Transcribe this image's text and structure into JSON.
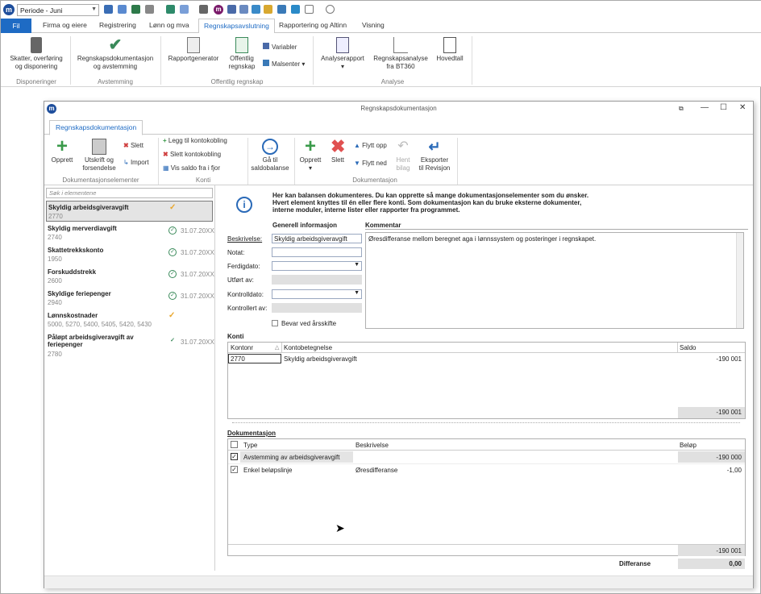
{
  "qat": {
    "period": "Periode - Juni"
  },
  "tabs": {
    "fil": "Fil",
    "t1": "Firma og eiere",
    "t2": "Registrering",
    "t3": "Lønn og mva",
    "t4": "Regnskapsavslutning",
    "t5": "Rapportering og Altinn",
    "t6": "Visning"
  },
  "ribbon": {
    "b1": "Skatter, overføring",
    "b1b": "og disponering",
    "g1": "Disponeringer",
    "b2": "Regnskapsdokumentasjon",
    "b2b": "og avstemming",
    "g2": "Avstemming",
    "b3": "Rapportgenerator",
    "b4": "Offentlig",
    "b4b": "regnskap",
    "b5": "Variabler",
    "b6": "Malsenter",
    "g3": "Offentlig regnskap",
    "b7": "Analyserapport",
    "b8": "Regnskapsanalyse",
    "b8b": "fra BT360",
    "b9": "Hovedtall",
    "g4": "Analyse"
  },
  "window": {
    "title": "Regnskapsdokumentasjon",
    "tab": "Regnskapsdokumentasjon"
  },
  "wribbon": {
    "opprett": "Opprett",
    "utskrift": "Utskrift og",
    "utskrift2": "forsendelse",
    "slett": "Slett",
    "import": "Import",
    "g1": "Dokumentasjonselementer",
    "legg": "Legg til kontokobling",
    "slettk": "Slett kontokobling",
    "vis": "Vis saldo fra i fjor",
    "g2": "Konti",
    "gaa": "Gå til",
    "gaa2": "saldobalanse",
    "opprett2": "Opprett",
    "slett2": "Slett",
    "opp": "Flytt opp",
    "ned": "Flytt ned",
    "hent": "Hent",
    "hent2": "bilag",
    "eksp": "Eksporter",
    "eksp2": "til Revisjon",
    "g3": "Dokumentasjon"
  },
  "list": {
    "search": "Søk i elementene",
    "items": [
      {
        "name": "Skyldig arbeidsgiveravgift",
        "code": "2770",
        "date": ""
      },
      {
        "name": "Skyldig merverdiavgift",
        "code": "2740",
        "date": "31.07.20XX"
      },
      {
        "name": "Skattetrekkskonto",
        "code": "1950",
        "date": "31.07.20XX"
      },
      {
        "name": "Forskuddstrekk",
        "code": "2600",
        "date": "31.07.20XX"
      },
      {
        "name": "Skyldige feriepenger",
        "code": "2940",
        "date": "31.07.20XX"
      },
      {
        "name": "Lønnskostnader",
        "code": "5000, 5270, 5400, 5405, 5420, 5430",
        "date": ""
      },
      {
        "name": "Påløpt arbeidsgiveravgift av",
        "name2": "feriepenger",
        "code": "2780",
        "date": "31.07.20XX"
      }
    ]
  },
  "info": {
    "l1": "Her kan balansen dokumenteres. Du kan opprette så mange dokumentasjonselementer som du ønsker.",
    "l2": "Hvert element knyttes til én eller flere konti. Som dokumentasjon kan du bruke eksterne dokumenter,",
    "l3": "interne moduler, interne lister eller rapporter fra programmet."
  },
  "form": {
    "gen": "Generell informasjon",
    "komhdr": "Kommentar",
    "beskr": "Beskrivelse:",
    "beskr_val": "Skyldig arbeidsgiveravgift",
    "notat": "Notat:",
    "ferdig": "Ferdigdato:",
    "utfort": "Utført av:",
    "kontrolldato": "Kontrolldato:",
    "kontrollert": "Kontrollert av:",
    "bevar": "Bevar ved årsskifte",
    "kommentar": "Øresdifferanse mellom beregnet aga i lønnssystem og posteringer i regnskapet."
  },
  "konti": {
    "hdr": "Konti",
    "c1": "Kontonr",
    "c2": "Kontobetegnelse",
    "c3": "Saldo",
    "row_nr": "2770",
    "row_name": "Skyldig arbeidsgiveravgift",
    "row_saldo": "-190 001",
    "total": "-190 001"
  },
  "dok": {
    "hdr": "Dokumentasjon",
    "c1": "Type",
    "c2": "Beskrivelse",
    "c3": "Beløp",
    "r1_type": "Avstemming av arbeidsgiveravgift",
    "r1_desc": "",
    "r1_amt": "-190 000",
    "r2_type": "Enkel beløpslinje",
    "r2_desc": "Øresdifferanse",
    "r2_amt": "-1,00",
    "total": "-190 001",
    "diff_lbl": "Differanse",
    "diff_val": "0,00"
  }
}
